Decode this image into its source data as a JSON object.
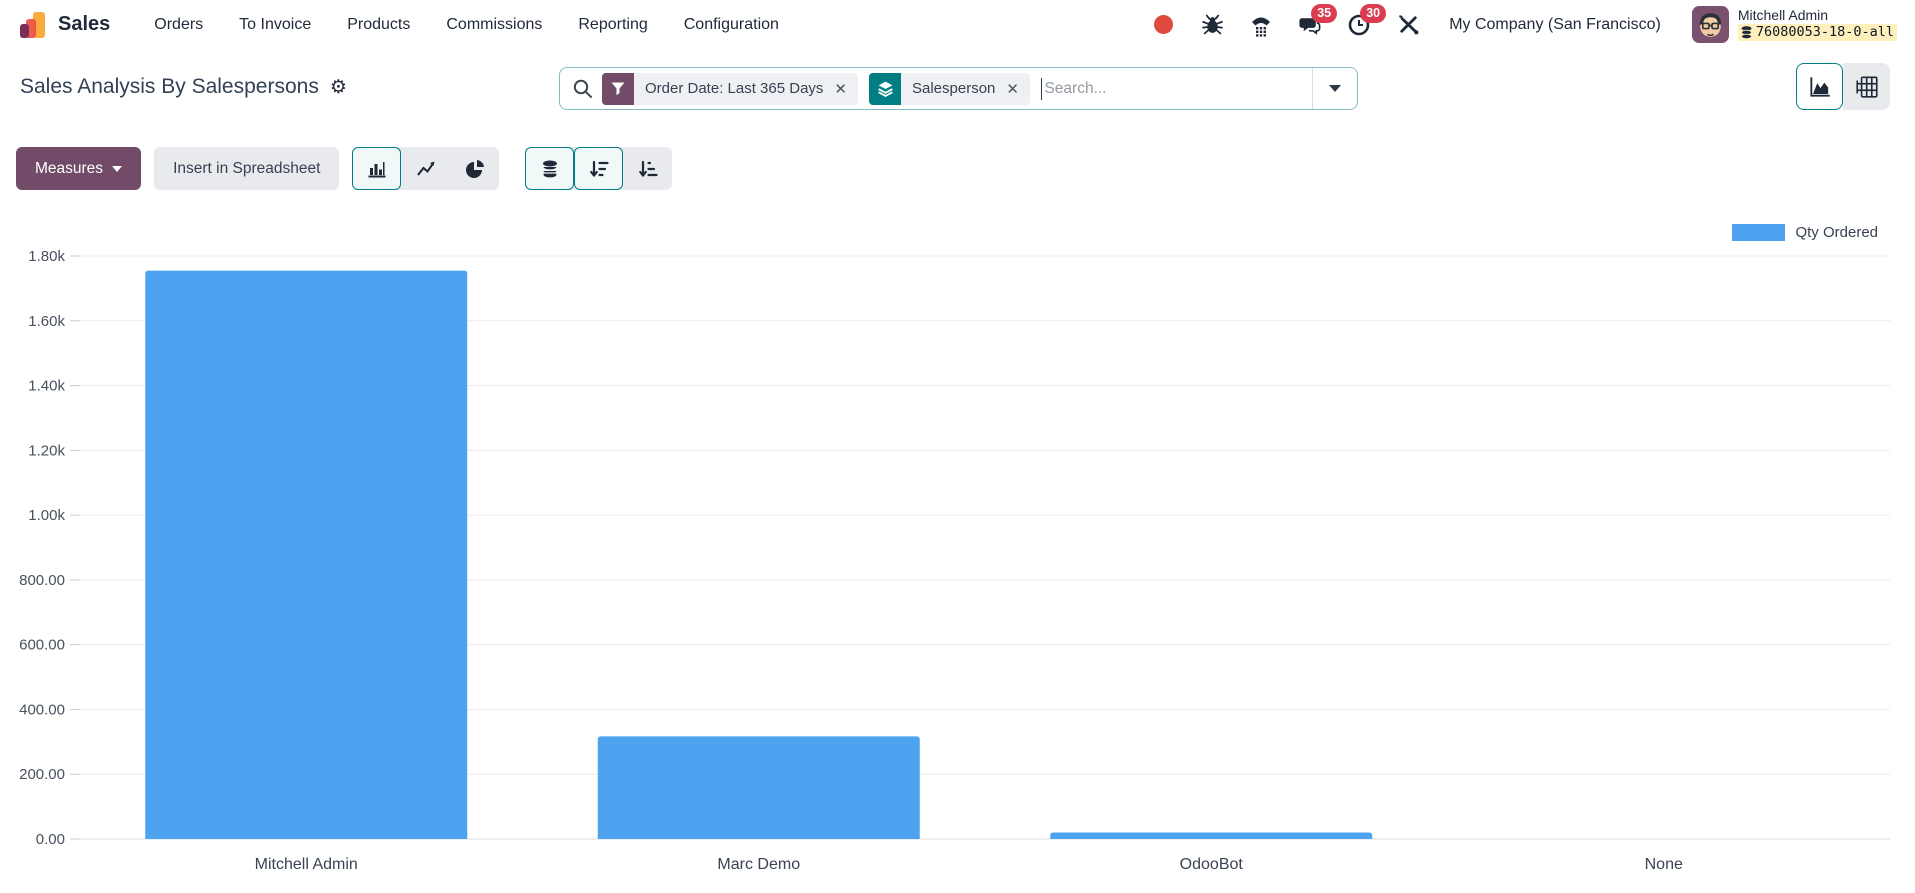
{
  "topbar": {
    "app_name": "Sales",
    "menu_items": [
      "Orders",
      "To Invoice",
      "Products",
      "Commissions",
      "Reporting",
      "Configuration"
    ],
    "messages_badge": "35",
    "activities_badge": "30",
    "company_name": "My Company (San Francisco)",
    "user_name": "Mitchell Admin",
    "db_version": "76080053-18-0-all"
  },
  "control_panel": {
    "title": "Sales Analysis By Salespersons",
    "search": {
      "facets": [
        {
          "kind": "filter",
          "label": "Order Date: Last 365 Days"
        },
        {
          "kind": "groupby",
          "label": "Salesperson"
        }
      ],
      "placeholder": "Search..."
    }
  },
  "toolbar": {
    "measures_label": "Measures",
    "insert_spreadsheet_label": "Insert in Spreadsheet"
  },
  "chart_data": {
    "type": "bar",
    "title": "",
    "xlabel": "",
    "ylabel": "",
    "categories": [
      "Mitchell Admin",
      "Marc Demo",
      "OdooBot",
      "None"
    ],
    "series": [
      {
        "name": "Qty Ordered",
        "color": "#4da3ef",
        "values": [
          1755,
          317,
          20,
          0
        ]
      }
    ],
    "ylim": [
      0,
      1800
    ],
    "ytick_values": [
      0,
      200,
      400,
      600,
      800,
      1000,
      1200,
      1400,
      1600,
      1800
    ],
    "ytick_labels": [
      "0.00",
      "200.00",
      "400.00",
      "600.00",
      "800.00",
      "1.00k",
      "1.20k",
      "1.40k",
      "1.60k",
      "1.80k"
    ],
    "grid": true,
    "legend": {
      "position": "top-right"
    }
  },
  "colors": {
    "primary_purple": "#714b67",
    "accent_teal": "#017e84",
    "bar_blue": "#4da3ef",
    "badge_red": "#dc3c50",
    "db_badge_bg": "#fdf0bd"
  }
}
